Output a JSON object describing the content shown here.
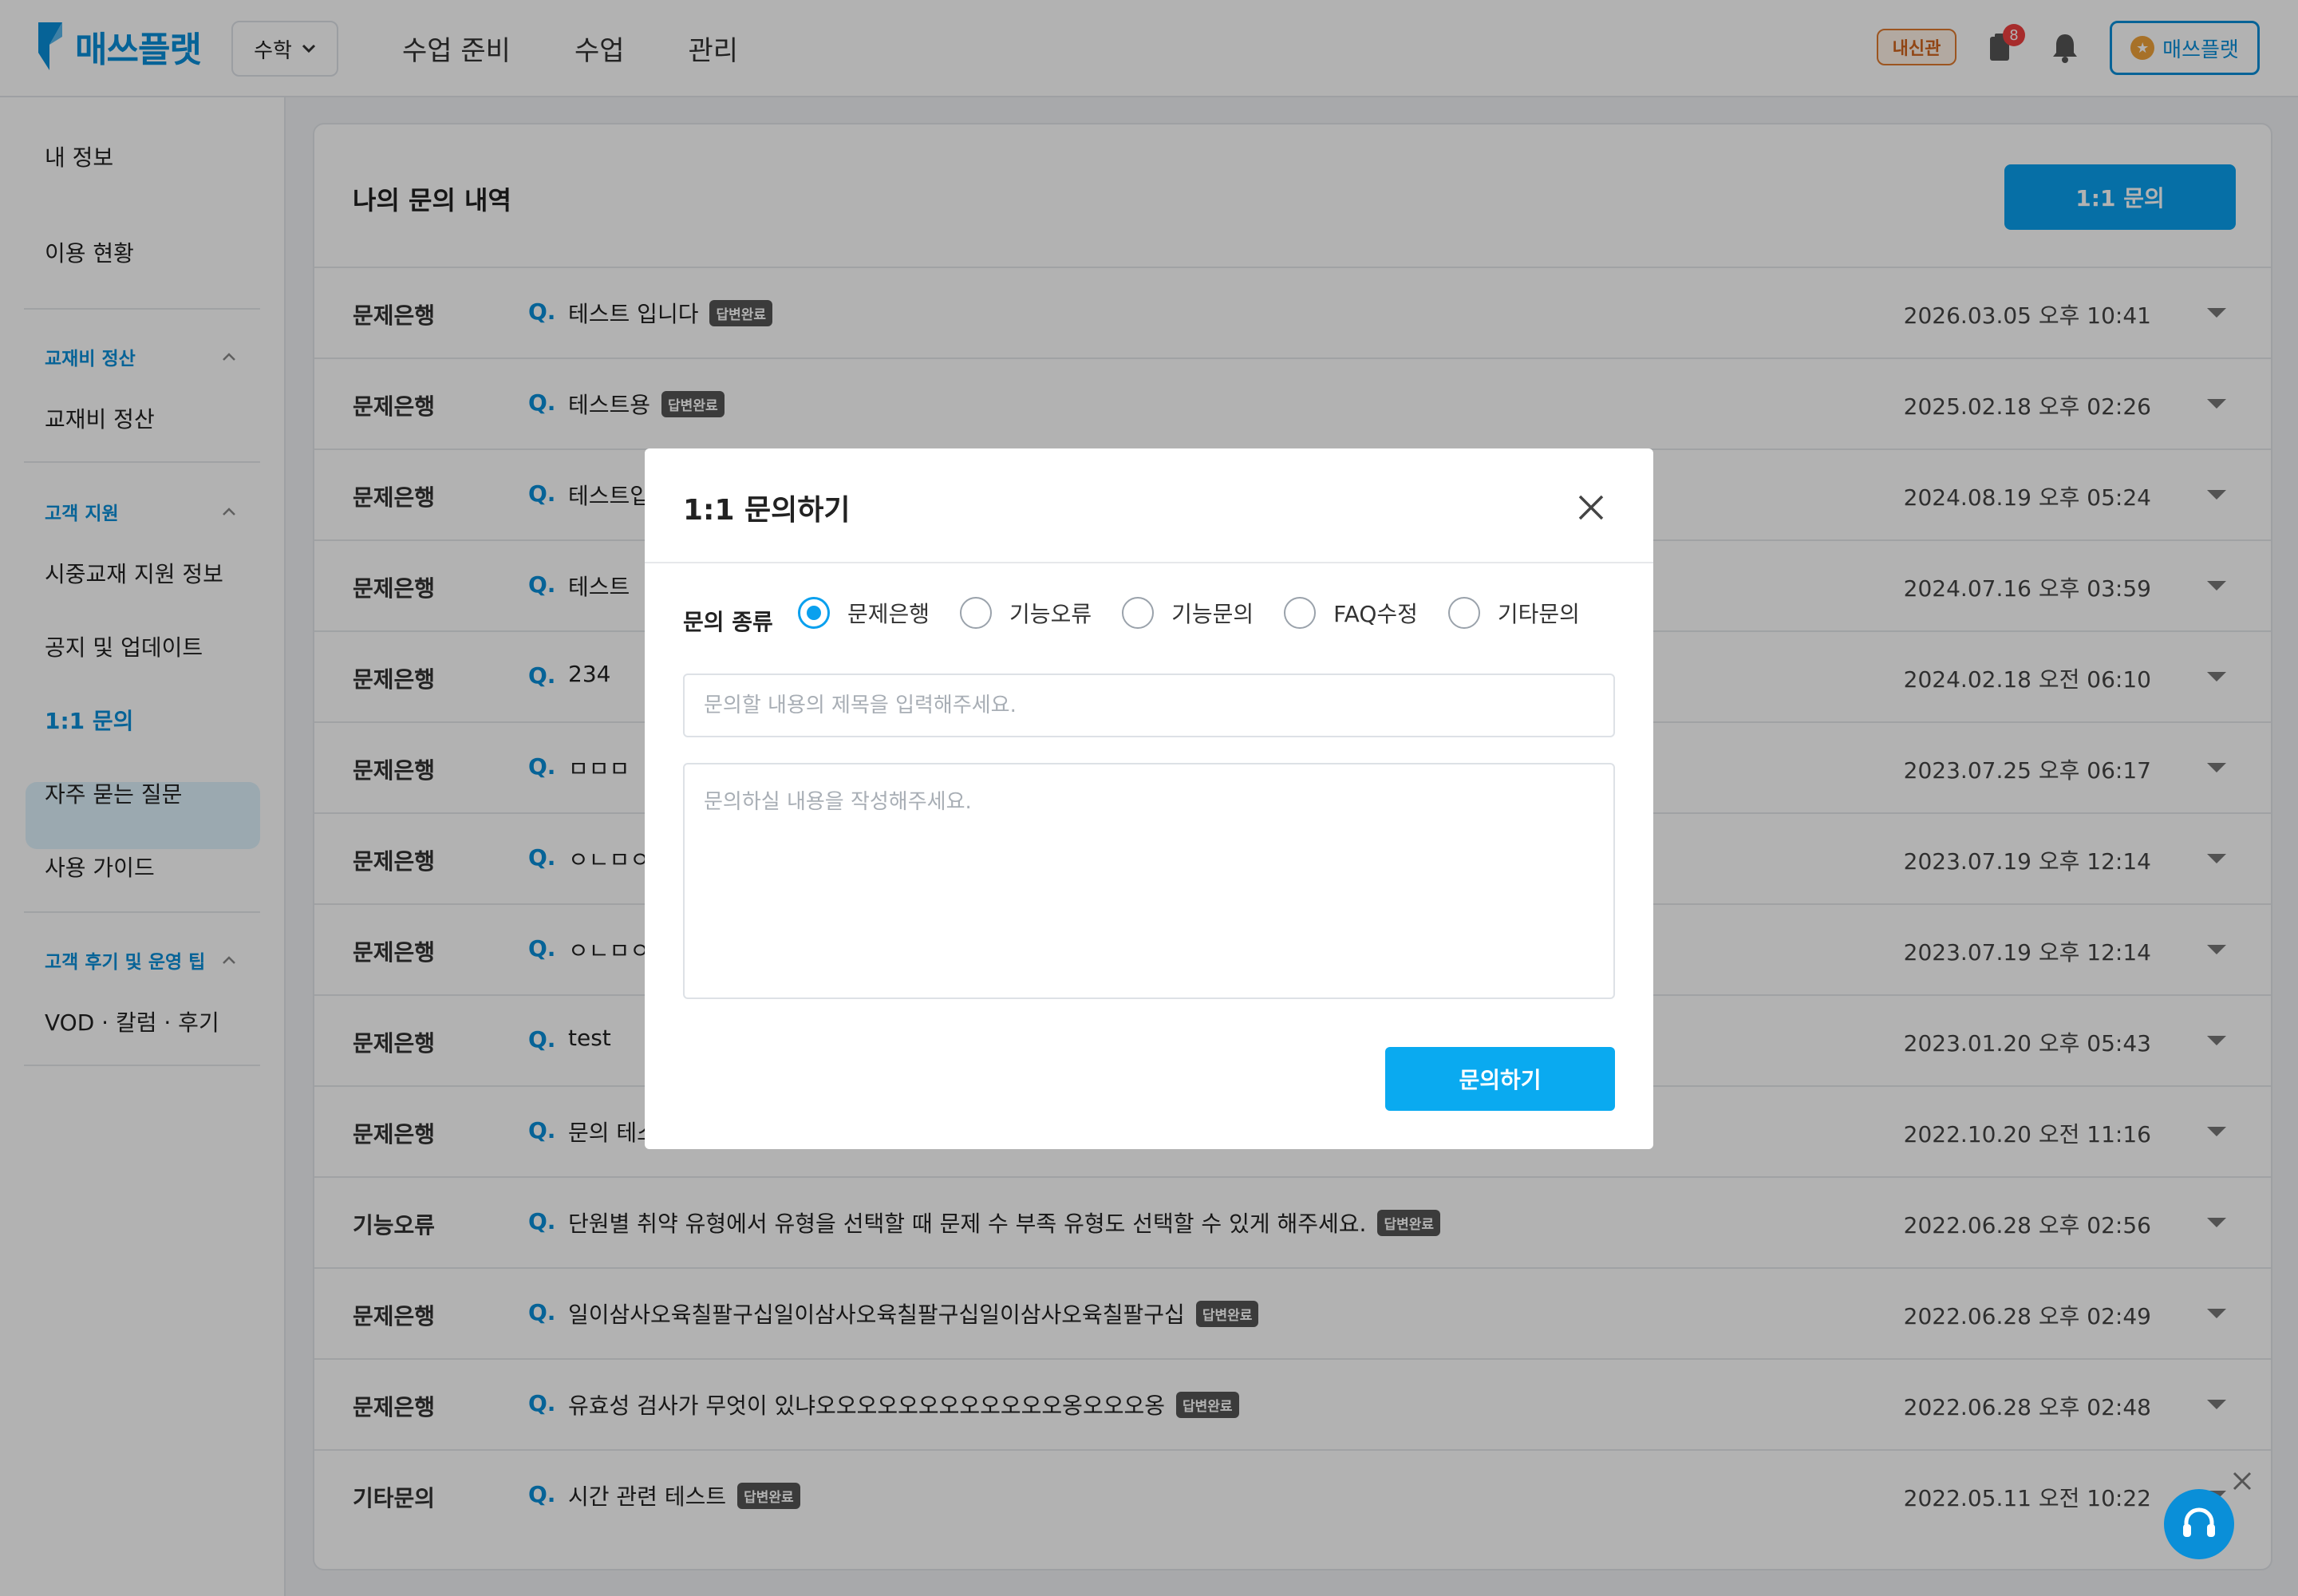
{
  "header": {
    "logo_text": "매쓰플랫",
    "subject": "수학",
    "nav": [
      "수업 준비",
      "수업",
      "관리"
    ],
    "school_badge": "내신관",
    "notification_count": "8",
    "user_button": "매쓰플랫"
  },
  "sidebar": {
    "my_info": "내 정보",
    "usage": "이용 현황",
    "group1": "교재비 정산",
    "group1_item": "교재비 정산",
    "group2": "고객 지원",
    "group2_items": [
      "시중교재 지원 정보",
      "공지 및 업데이트",
      "1:1 문의",
      "자주 묻는 질문",
      "사용 가이드"
    ],
    "group3": "고객 후기 및 운영 팁",
    "group3_item": "VOD · 칼럼 · 후기"
  },
  "main": {
    "title": "나의 문의 내역",
    "inquiry_button": "1:1 문의",
    "rows": [
      {
        "cat": "문제은행",
        "q": "Q.",
        "title": "테스트 입니다",
        "tag": "답변완료",
        "date": "2026.03.05 오후 10:41"
      },
      {
        "cat": "문제은행",
        "q": "Q.",
        "title": "테스트용",
        "tag": "답변완료",
        "date": "2025.02.18 오후 02:26"
      },
      {
        "cat": "문제은행",
        "q": "Q.",
        "title": "테스트입",
        "tag": "",
        "date": "2024.08.19 오후 05:24"
      },
      {
        "cat": "문제은행",
        "q": "Q.",
        "title": "테스트",
        "tag": "",
        "date": "2024.07.16 오후 03:59"
      },
      {
        "cat": "문제은행",
        "q": "Q.",
        "title": "234",
        "tag": "",
        "date": "2024.02.18 오전 06:10"
      },
      {
        "cat": "문제은행",
        "q": "Q.",
        "title": "ㅁㅁㅁ",
        "tag": "",
        "date": "2023.07.25 오후 06:17"
      },
      {
        "cat": "문제은행",
        "q": "Q.",
        "title": "ㅇㄴㅁㅇ",
        "tag": "",
        "date": "2023.07.19 오후 12:14"
      },
      {
        "cat": "문제은행",
        "q": "Q.",
        "title": "ㅇㄴㅁㅇ",
        "tag": "",
        "date": "2023.07.19 오후 12:14"
      },
      {
        "cat": "문제은행",
        "q": "Q.",
        "title": "test",
        "tag": "",
        "date": "2023.01.20 오후 05:43"
      },
      {
        "cat": "문제은행",
        "q": "Q.",
        "title": "문의 테스",
        "tag": "",
        "date": "2022.10.20 오전 11:16"
      },
      {
        "cat": "기능오류",
        "q": "Q.",
        "title": "단원별 취약 유형에서 유형을 선택할 때 문제 수 부족 유형도 선택할 수 있게 해주세요.",
        "tag": "답변완료",
        "date": "2022.06.28 오후 02:56"
      },
      {
        "cat": "문제은행",
        "q": "Q.",
        "title": "일이삼사오육칠팔구십일이삼사오육칠팔구십일이삼사오육칠팔구십",
        "tag": "답변완료",
        "date": "2022.06.28 오후 02:49"
      },
      {
        "cat": "문제은행",
        "q": "Q.",
        "title": "유효성 검사가 무엇이 있냐오오오오오오오오오오오오옹오오오옹",
        "tag": "답변완료",
        "date": "2022.06.28 오후 02:48"
      },
      {
        "cat": "기타문의",
        "q": "Q.",
        "title": "시간 관련 테스트",
        "tag": "답변완료",
        "date": "2022.05.11 오전 10:22"
      }
    ]
  },
  "modal": {
    "title": "1:1 문의하기",
    "type_label": "문의 종류",
    "options": [
      "문제은행",
      "기능오류",
      "기능문의",
      "FAQ수정",
      "기타문의"
    ],
    "selected": "문제은행",
    "title_placeholder": "문의할 내용의 제목을 입력해주세요.",
    "body_placeholder": "문의하실 내용을 작성해주세요.",
    "submit": "문의하기"
  },
  "colors": {
    "accent": "#0aa0ee",
    "brand": "#0a8fd8",
    "badge": "#e07a2f"
  }
}
